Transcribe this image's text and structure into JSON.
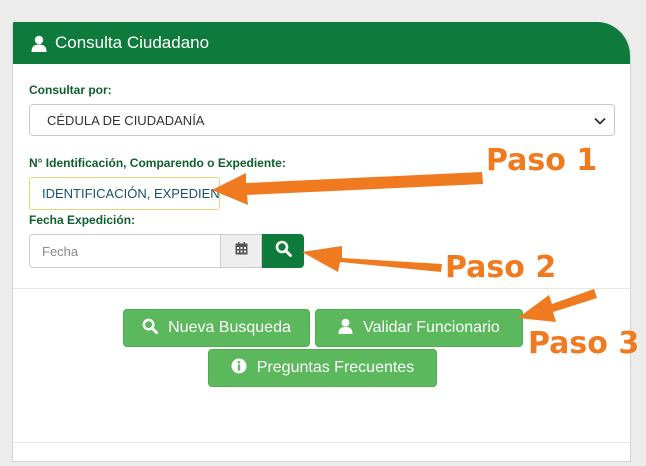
{
  "panel": {
    "title": "Consulta Ciudadano",
    "consultar_label": "Consultar por:",
    "consultar_value": "CÉDULA DE CIUDADANÍA",
    "id_label": "N° Identificación, Comparendo o Expediente:",
    "id_value": "IDENTIFICACIÓN, EXPEDIENTE",
    "fecha_label": "Fecha Expedición:",
    "fecha_placeholder": "Fecha"
  },
  "buttons": {
    "nueva_busqueda": "Nueva Busqueda",
    "validar_funcionario": "Validar Funcionario",
    "preguntas_frecuentes": "Preguntas Frecuentes"
  },
  "annotations": {
    "paso1": "Paso 1",
    "paso2": "Paso 2",
    "paso3": "Paso 3"
  },
  "colors": {
    "header_green": "#0e7a3b",
    "button_green": "#5cb85c",
    "annotation_orange": "#f07a20"
  },
  "icons": {
    "header": "user-icon",
    "calendar": "calendar-icon",
    "search": "search-icon",
    "nueva_busqueda": "search-icon",
    "validar_funcionario": "user-icon",
    "preguntas_frecuentes": "info-icon",
    "select": "chevron-down-icon"
  }
}
